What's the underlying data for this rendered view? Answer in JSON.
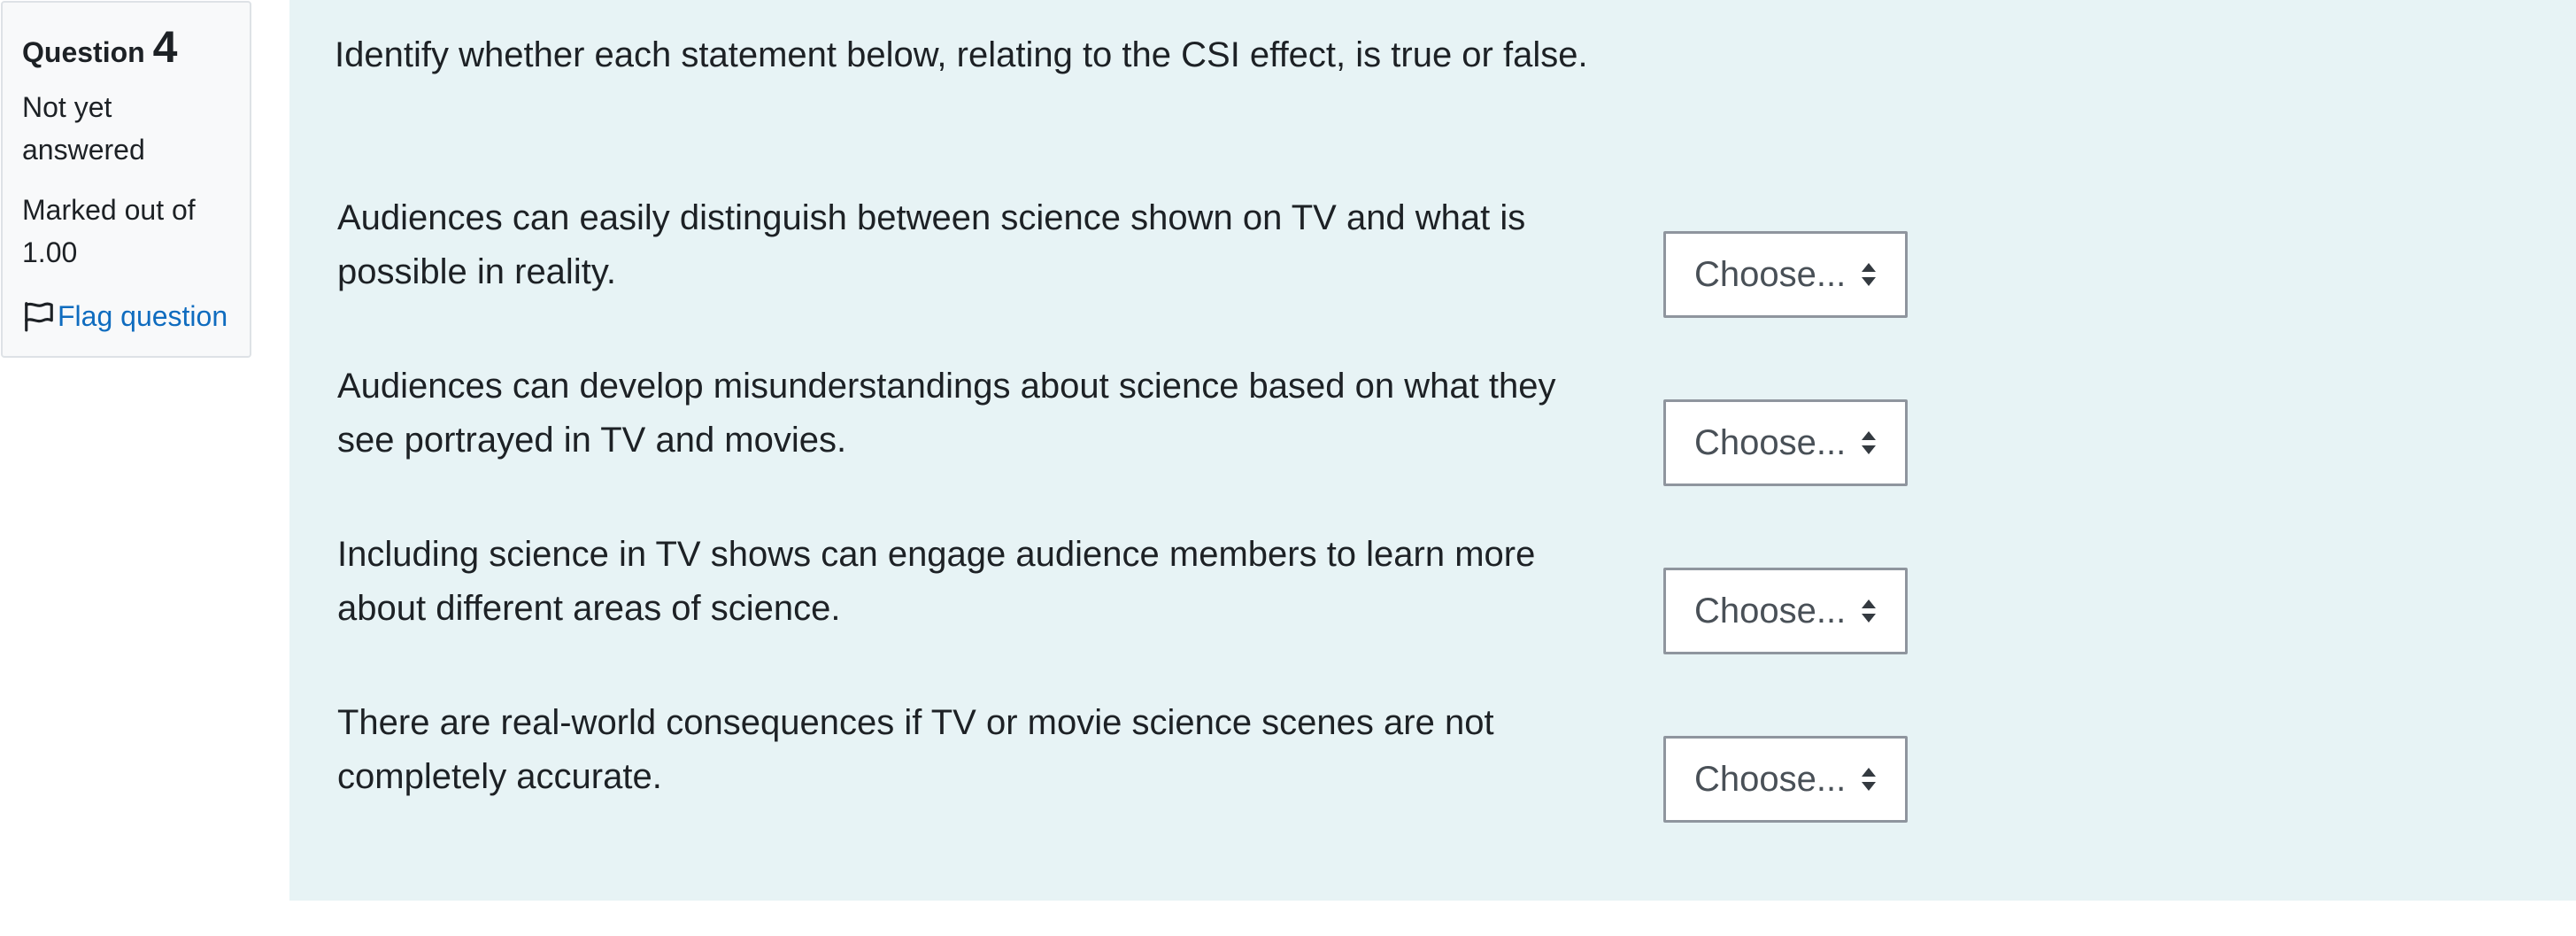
{
  "question_info": {
    "label": "Question",
    "number": "4",
    "state": "Not yet answered",
    "grade": "Marked out of 1.00",
    "flag_label": "Flag question",
    "flag_icon": "flag-outline-icon"
  },
  "question": {
    "text": "Identify whether each statement below, relating to the CSI effect, is true or false.",
    "items": [
      {
        "statement": "Audiences can easily distinguish between science shown on TV and what is possible in reality.",
        "select_value": "Choose..."
      },
      {
        "statement": "Audiences can develop misunderstandings about science based on what they see portrayed in TV and movies.",
        "select_value": "Choose..."
      },
      {
        "statement": "Including science in TV shows can engage audience members to learn more about different areas of science.",
        "select_value": "Choose..."
      },
      {
        "statement": "There are real-world consequences if TV or movie science scenes are not completely accurate.",
        "select_value": "Choose..."
      }
    ]
  },
  "colors": {
    "content_background": "#e7f3f5",
    "info_background": "#f8f9fa",
    "link": "#0f6cbf",
    "text": "#1d2125"
  }
}
